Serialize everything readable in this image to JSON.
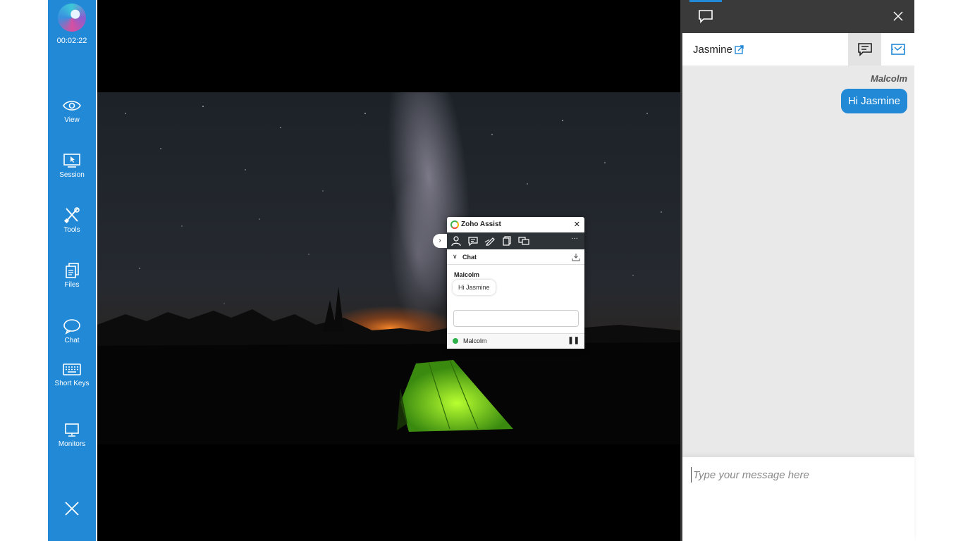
{
  "sidebar": {
    "timer": "00:02:22",
    "items": [
      {
        "label": "View"
      },
      {
        "label": "Session"
      },
      {
        "label": "Tools"
      },
      {
        "label": "Files"
      },
      {
        "label": "Chat"
      },
      {
        "label": "Short Keys"
      },
      {
        "label": "Monitors"
      }
    ],
    "color": "#2289d6"
  },
  "widget": {
    "title": "Zoho Assist",
    "section_title": "Chat",
    "sender": "Malcolm",
    "message": "Hi Jasmine",
    "footer_user": "Malcolm",
    "collapse_glyph": "›",
    "close_glyph": "✕",
    "chevron_glyph": "∨",
    "pause_glyph": "❚❚",
    "more_glyph": "···",
    "toolbar_icons": [
      "user-icon",
      "chat-icon",
      "annotate-icon",
      "clipboard-icon",
      "switch-monitor-icon",
      "more-icon"
    ]
  },
  "panel": {
    "contact_name": "Jasmine",
    "sender": "Malcolm",
    "message": "Hi Jasmine",
    "input_placeholder": "Type your message here",
    "accent": "#2289d6"
  }
}
